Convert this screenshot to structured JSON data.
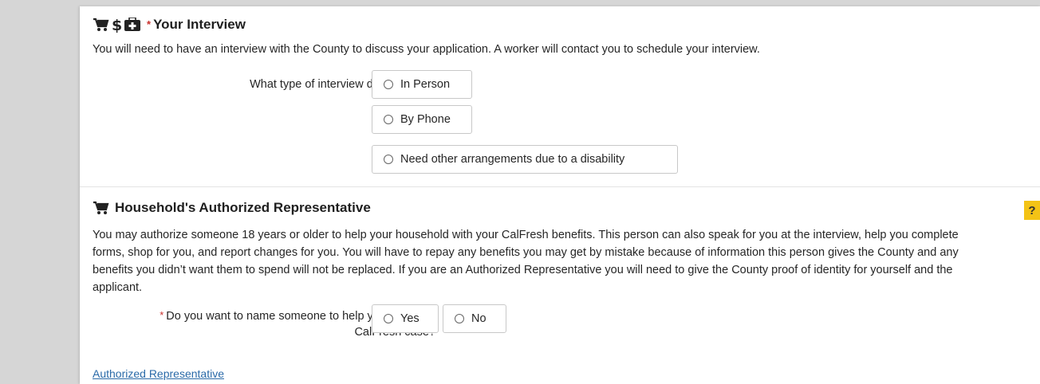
{
  "interview": {
    "title": "Your Interview",
    "required_mark": "*",
    "icons": [
      "cart-icon",
      "dollar-icon",
      "medical-kit-icon"
    ],
    "description": "You will need to have an interview with the County to discuss your application. A worker will contact you to schedule your interview.",
    "question": "What type of interview do you want?",
    "options": [
      "In Person",
      "By Phone",
      "Need other arrangements due to a disability"
    ]
  },
  "representative": {
    "title": "Household's Authorized Representative",
    "icons": [
      "cart-icon"
    ],
    "help_label": "?",
    "description_lines": [
      "You may authorize someone 18 years or older to help your household with your CalFresh benefits. This person can also speak for you at the interview, help you complete",
      "forms, shop for you, and report changes for you. You will have to repay any benefits you may get by mistake because of information this person gives the County and any",
      "benefits you didn’t want them to spend will not be replaced. If you are an Authorized Representative you will need to give the County proof of identity for yourself and the",
      "applicant."
    ],
    "required_mark": "*",
    "question_line1": "Do you want to name someone to help you with your",
    "question_line2": "CalFresh case?",
    "options": [
      "Yes",
      "No"
    ],
    "link_label": "Authorized Representative"
  },
  "colors": {
    "required": "#c9302c",
    "link": "#2a6aa8",
    "help_badge": "#f3c316"
  }
}
